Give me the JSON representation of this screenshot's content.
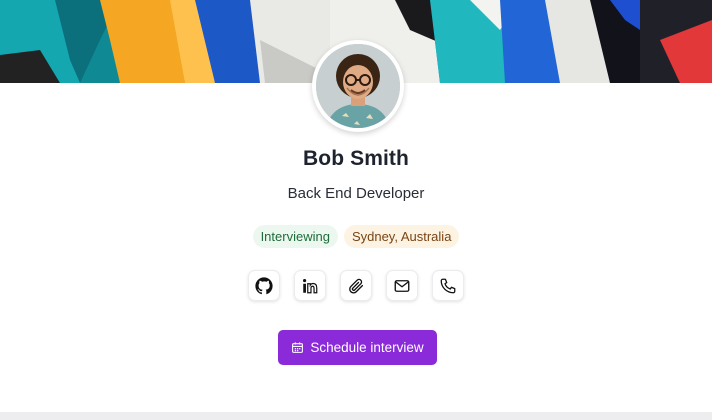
{
  "profile": {
    "name": "Bob Smith",
    "role": "Back End Developer",
    "status_badge": "Interviewing",
    "location_badge": "Sydney, Australia"
  },
  "contact_icons": [
    {
      "icon": "github-icon"
    },
    {
      "icon": "linkedin-icon"
    },
    {
      "icon": "paperclip-icon"
    },
    {
      "icon": "mail-icon"
    },
    {
      "icon": "phone-icon"
    }
  ],
  "actions": {
    "schedule_label": "Schedule interview",
    "schedule_icon": "calendar-icon"
  },
  "colors": {
    "accent": "#8b2ad8",
    "status_bg": "#ecf8ef",
    "status_fg": "#1f6b3a",
    "location_bg": "#fdf3e3",
    "location_fg": "#7a4413"
  }
}
